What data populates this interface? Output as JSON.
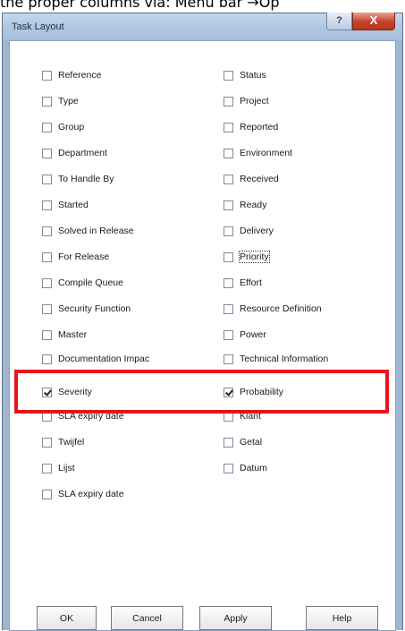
{
  "caption": "the proper columns via: Menu bar →Op",
  "window": {
    "title": "Task Layout",
    "help_glyph": "?",
    "close_glyph": "X"
  },
  "options": {
    "left": [
      {
        "label": "Reference",
        "checked": false
      },
      {
        "label": "Type",
        "checked": false
      },
      {
        "label": "Group",
        "checked": false
      },
      {
        "label": "Department",
        "checked": false
      },
      {
        "label": "To Handle By",
        "checked": false
      },
      {
        "label": "Started",
        "checked": false
      },
      {
        "label": "Solved in Release",
        "checked": false
      },
      {
        "label": "For Release",
        "checked": false
      },
      {
        "label": "Compile Queue",
        "checked": false
      },
      {
        "label": "Security Function",
        "checked": false
      },
      {
        "label": "Master",
        "checked": false
      },
      {
        "label": "Documentation Impac",
        "checked": false
      },
      {
        "label": "Severity",
        "checked": true
      },
      {
        "label": "SLA expiry date",
        "checked": false
      },
      {
        "label": "Twijfel",
        "checked": false
      },
      {
        "label": "Lijst",
        "checked": false
      },
      {
        "label": "SLA expiry date",
        "checked": false
      }
    ],
    "right": [
      {
        "label": "Status",
        "checked": false
      },
      {
        "label": "Project",
        "checked": false
      },
      {
        "label": "Reported",
        "checked": false
      },
      {
        "label": "Environment",
        "checked": false
      },
      {
        "label": "Received",
        "checked": false
      },
      {
        "label": "Ready",
        "checked": false
      },
      {
        "label": "Delivery",
        "checked": false
      },
      {
        "label": "Priority",
        "checked": false
      },
      {
        "label": "Effort",
        "checked": false
      },
      {
        "label": "Resource Definition",
        "checked": false
      },
      {
        "label": "Power",
        "checked": false
      },
      {
        "label": "Technical Information",
        "checked": false
      },
      {
        "label": "Probability",
        "checked": true
      },
      {
        "label": "Klant",
        "checked": false
      },
      {
        "label": "Getal",
        "checked": false
      },
      {
        "label": "Datum",
        "checked": false
      }
    ]
  },
  "buttons": {
    "ok": "OK",
    "cancel": "Cancel",
    "apply": "Apply",
    "help": "Help"
  },
  "colors": {
    "highlight": "#e8141c",
    "frame": "#9fb6d0"
  }
}
